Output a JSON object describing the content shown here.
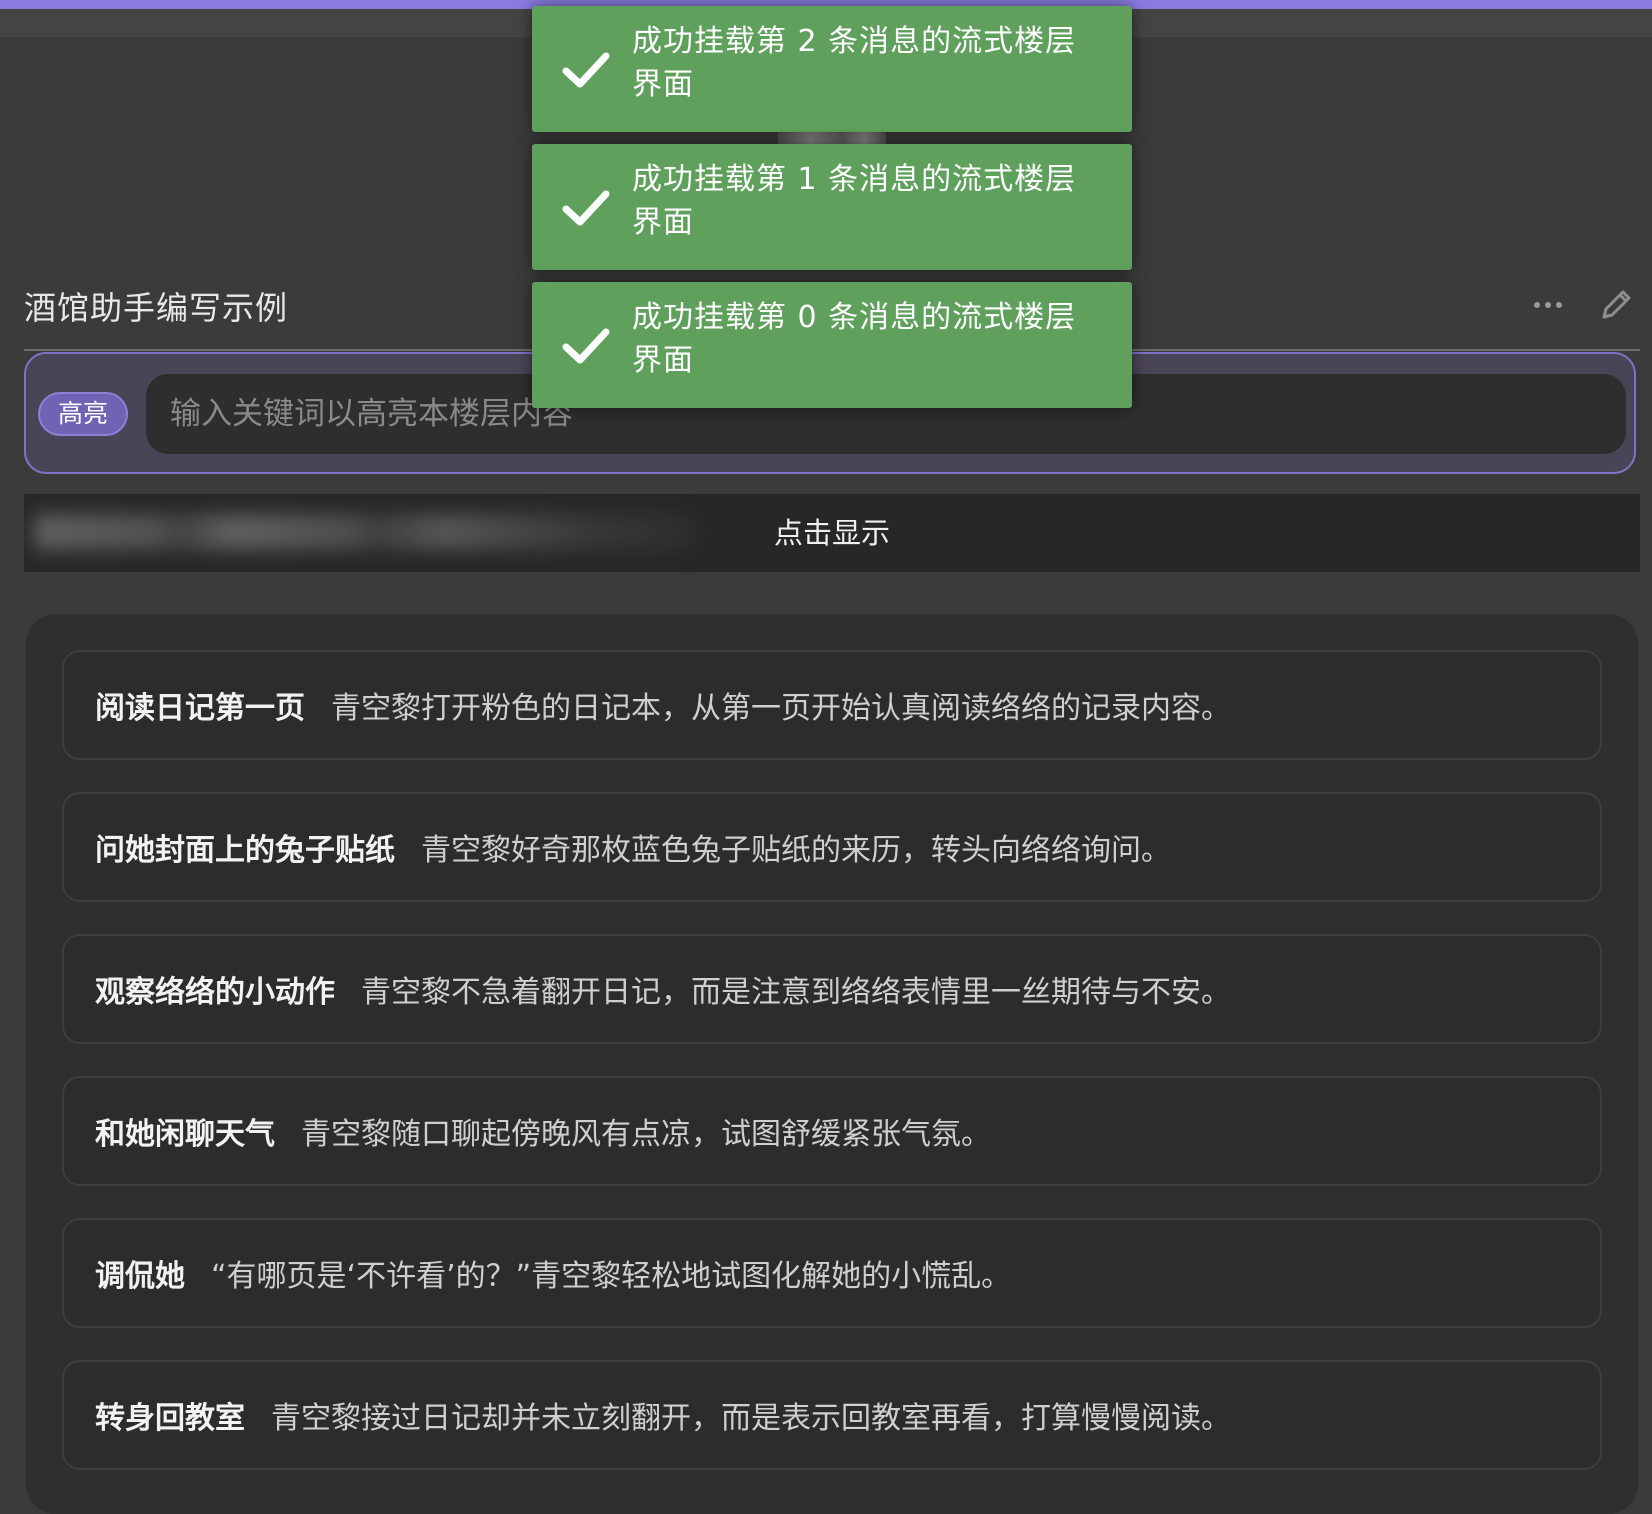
{
  "toasts": [
    {
      "text": "成功挂载第 2 条消息的流式楼层界面",
      "icon": "check-icon"
    },
    {
      "text": "成功挂载第 1 条消息的流式楼层界面",
      "icon": "check-icon"
    },
    {
      "text": "成功挂载第 0 条消息的流式楼层界面",
      "icon": "check-icon"
    }
  ],
  "message": {
    "title": "酒馆助手编写示例",
    "more_icon": "more-icon",
    "edit_icon": "pencil-icon"
  },
  "highlight": {
    "pill_label": "高亮",
    "placeholder": "输入关键词以高亮本楼层内容",
    "value": ""
  },
  "spoiler": {
    "label": "点击显示"
  },
  "options": [
    {
      "title": "阅读日记第一页",
      "desc": "青空黎打开粉色的日记本，从第一页开始认真阅读络络的记录内容。"
    },
    {
      "title": "问她封面上的兔子贴纸",
      "desc": "青空黎好奇那枚蓝色兔子贴纸的来历，转头向络络询问。"
    },
    {
      "title": "观察络络的小动作",
      "desc": "青空黎不急着翻开日记，而是注意到络络表情里一丝期待与不安。"
    },
    {
      "title": "和她闲聊天气",
      "desc": "青空黎随口聊起傍晚风有点凉，试图舒缓紧张气氛。"
    },
    {
      "title": "调侃她",
      "desc": "“有哪页是‘不许看’的？”青空黎轻松地试图化解她的小慌乱。"
    },
    {
      "title": "转身回教室",
      "desc": "青空黎接过日记却并未立刻翻开，而是表示回教室再看，打算慢慢阅读。"
    }
  ],
  "colors": {
    "accent": "#8b7be0",
    "toast_success": "#5fa05d",
    "background": "#3b3b3b"
  }
}
